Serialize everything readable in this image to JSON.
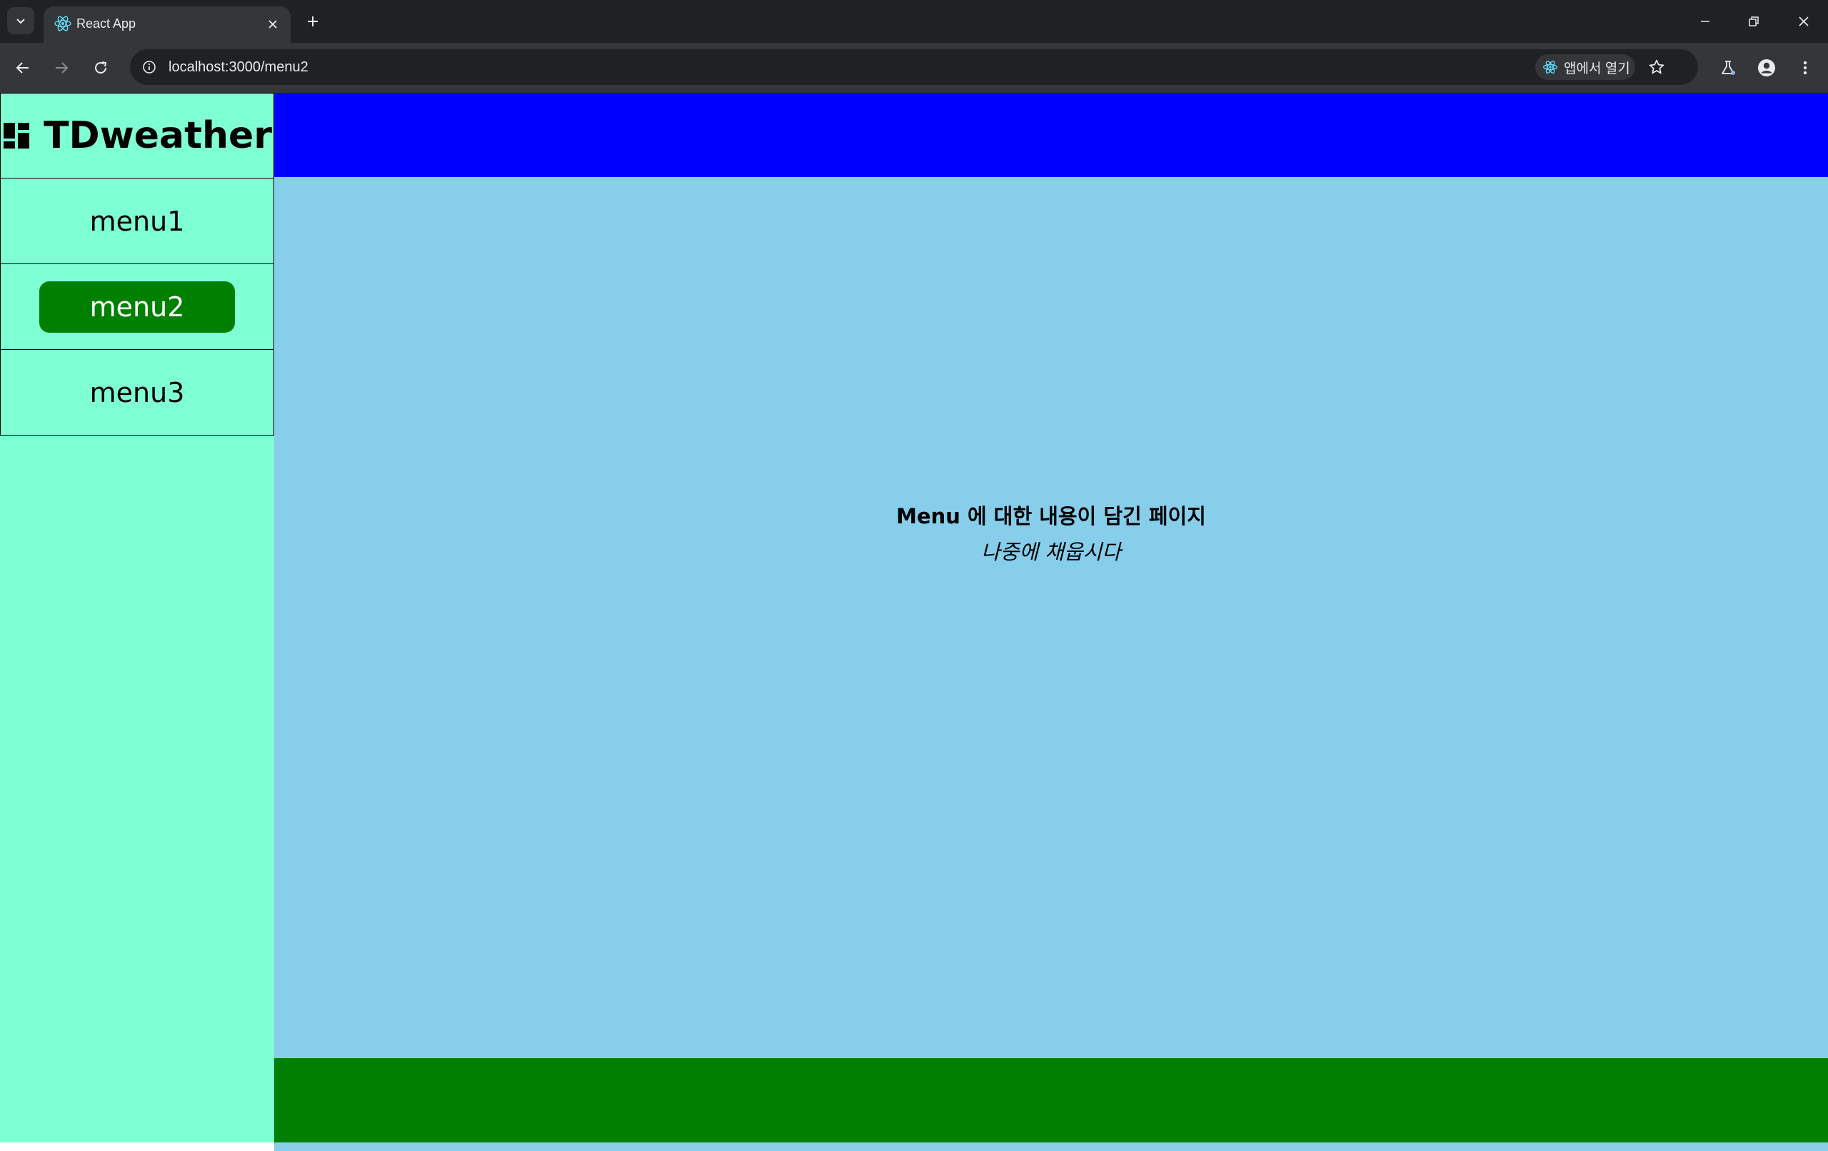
{
  "browser": {
    "tab_title": "React App",
    "url": "localhost:3000/menu2",
    "open_in_app_label": "앱에서 열기"
  },
  "sidebar": {
    "brand": "TDweather",
    "items": [
      {
        "label": "menu1",
        "active": false
      },
      {
        "label": "menu2",
        "active": true
      },
      {
        "label": "menu3",
        "active": false
      }
    ]
  },
  "main": {
    "title": "Menu 에 대한 내용이 담긴 페이지",
    "subtitle": "나중에 채웁시다"
  },
  "colors": {
    "sidebar_bg": "#7fffd4",
    "header_bg": "#0000ff",
    "content_bg": "#87ceeb",
    "footer_bg": "#008000",
    "active_item": "#008000"
  }
}
